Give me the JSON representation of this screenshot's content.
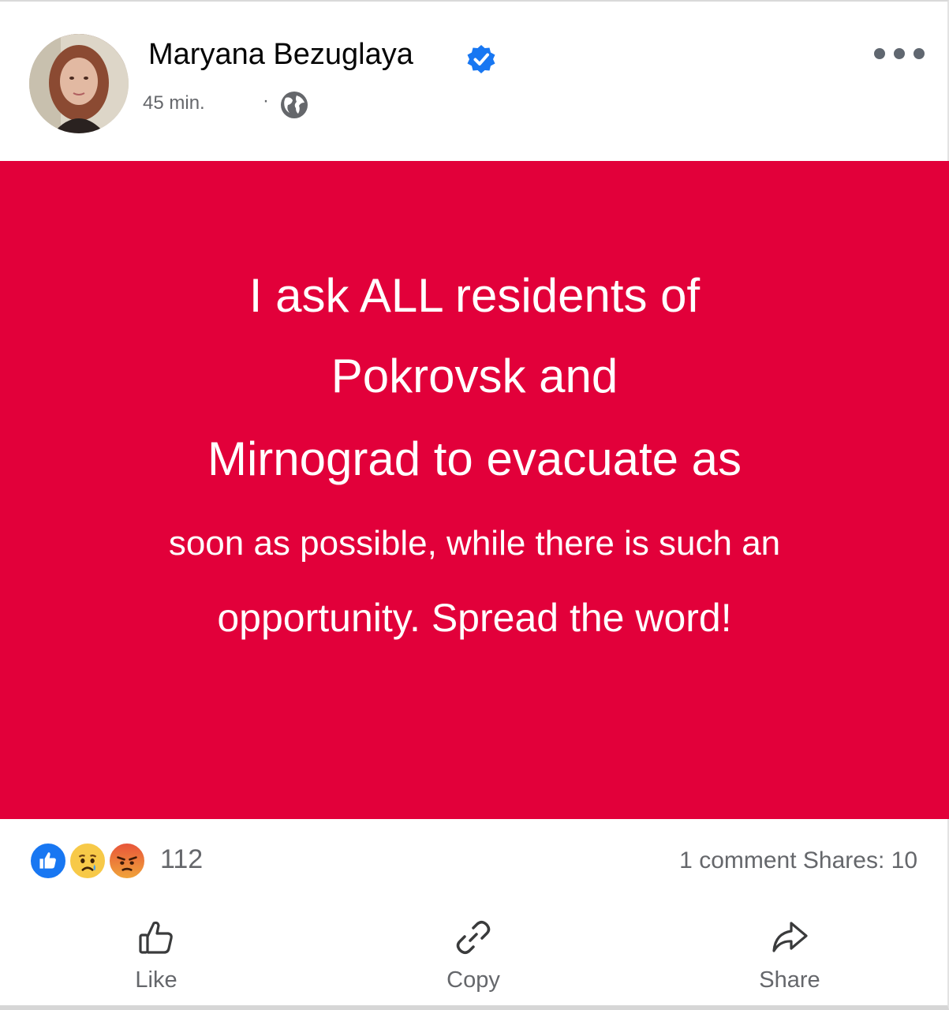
{
  "post": {
    "author": "Maryana Bezuglaya",
    "timestamp": "45 min.",
    "separator": "·",
    "verified_icon": "verified-badge-icon",
    "privacy_icon": "globe-icon",
    "more_icon": "more-options-icon",
    "card_color": "#e2003a",
    "text_lines": [
      "I ask ALL residents of",
      "Pokrovsk and",
      "Mirnograd to evacuate as",
      "soon as possible, while there is such an",
      "opportunity. Spread the word!"
    ]
  },
  "stats": {
    "reactions": [
      "like-reaction-icon",
      "sad-reaction-icon",
      "angry-reaction-icon"
    ],
    "reaction_count": "112",
    "comments": "1 comment",
    "shares": "Shares: 10"
  },
  "actions": {
    "like_label": "Like",
    "copy_label": "Copy",
    "share_label": "Share"
  },
  "colors": {
    "accent_blue": "#1877f2",
    "secondary_text": "#65676b"
  }
}
